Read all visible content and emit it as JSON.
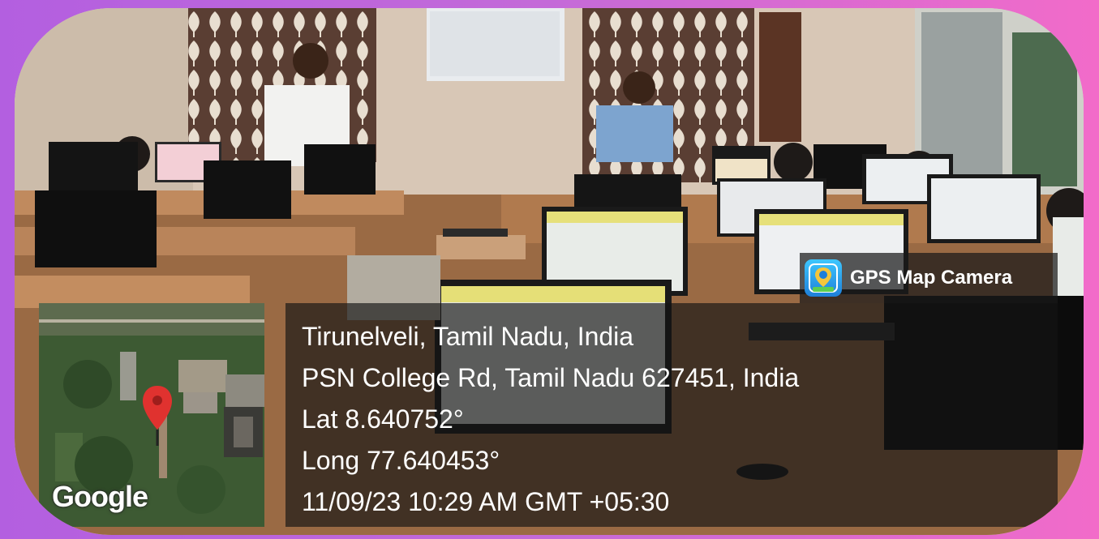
{
  "badge": {
    "label": "GPS Map Camera"
  },
  "map": {
    "brand": "Google"
  },
  "location": {
    "city_line": "Tirunelveli, Tamil Nadu, India",
    "address_line": "PSN College Rd, Tamil Nadu 627451, India",
    "lat": "Lat 8.640752°",
    "long": "Long 77.640453°",
    "datetime": "11/09/23 10:29 AM GMT +05:30"
  },
  "colors": {
    "frame_left": "#b35fe0",
    "frame_right": "#f26bc9",
    "pin": "#e0322f",
    "overlay": "rgba(20,20,20,0.66)"
  }
}
